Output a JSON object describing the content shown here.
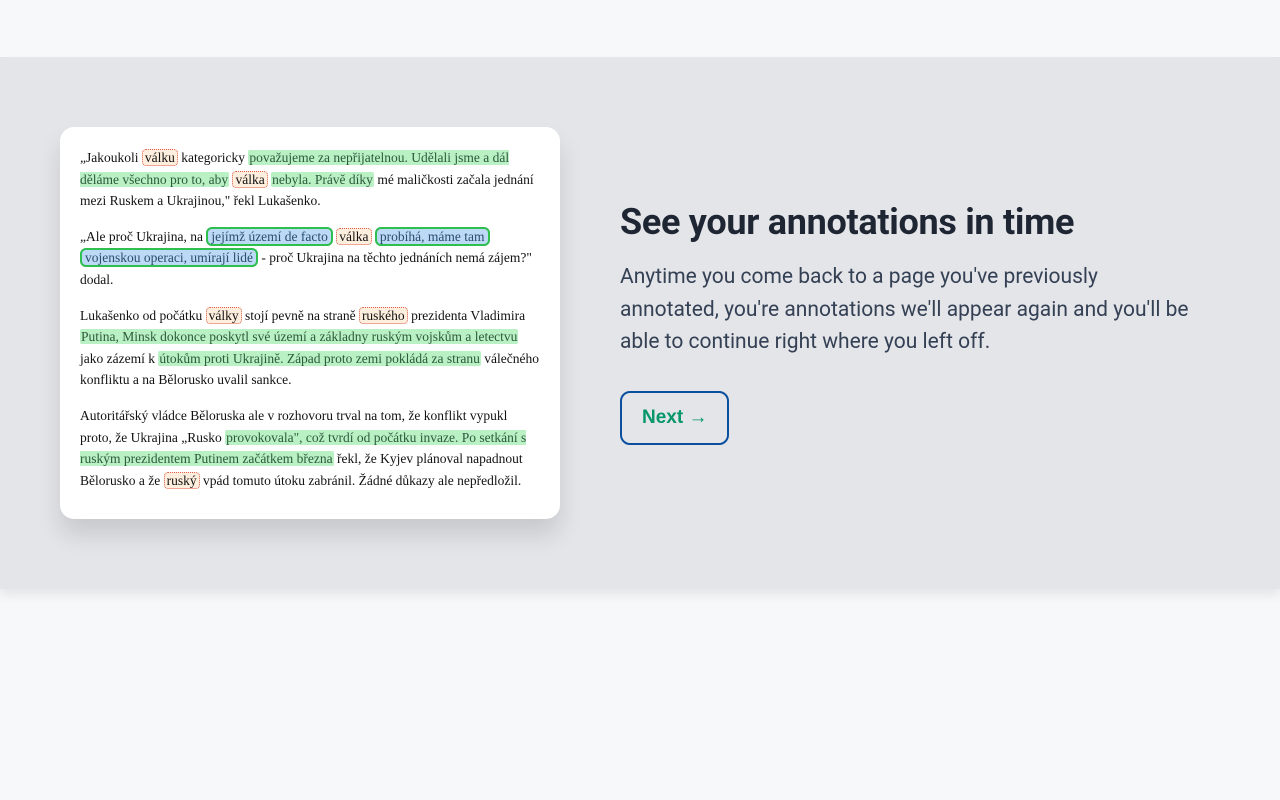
{
  "hero": {
    "headline": "See your annotations in time",
    "subtext": "Anytime you come back to a page you've previously annotated, you're annotations we'll appear again and you'll be able to continue right where you left off.",
    "next_label": "Next →"
  },
  "article": {
    "p1": {
      "t1": "„Jakoukoli ",
      "w_valku": "válku",
      "t2": " kategoricky ",
      "g1": "považujeme za nepřijatelnou. Udělali jsme a dál děláme všechno pro to, aby",
      "sp": " ",
      "w_valka": "válka",
      "sp2": " ",
      "g2": "nebyla. Právě díky",
      "t3": " mé maličkosti začala jednání mezi Ruskem a Ukrajinou,\" řekl Lukašenko."
    },
    "p2": {
      "t1": "„Ale proč Ukrajina, na ",
      "b1": "jejímž území de facto",
      "sp": " ",
      "w_valka": "válka",
      "sp2": " ",
      "b2": "probíhá, máme tam vojenskou operaci, umírají lidé",
      "t2": " - proč Ukrajina na těchto jednáních nemá zájem?\" dodal."
    },
    "p3": {
      "t1": "Lukašenko od počátku ",
      "w_valky": "války",
      "t2": " stojí pevně na straně ",
      "w_rusk": "ruského",
      "t3": " prezidenta Vladimira ",
      "g1": "Putina, Minsk dokonce poskytl své území a základny ruským vojskům a letectvu",
      "t4": " jako zázemí k ",
      "g2": "útokům proti Ukrajině. Západ proto zemi pokládá za stranu",
      "t5": " válečného konfliktu a na Bělorusko uvalil sankce."
    },
    "p4": {
      "t1": "Autoritářský vládce Běloruska ale v rozhovoru trval na tom, že konflikt vypukl proto, že Ukrajina „Rusko ",
      "g1": "provokovala\", což tvrdí od počátku invaze. Po setkání s ruským prezidentem Putinem začátkem března",
      "t2": " řekl, že Kyjev plánoval napadnout Bělorusko a že ",
      "w_rusky": "ruský",
      "t3": " vpád tomuto útoku zabránil. Žádné důkazy ale nepředložil."
    }
  }
}
